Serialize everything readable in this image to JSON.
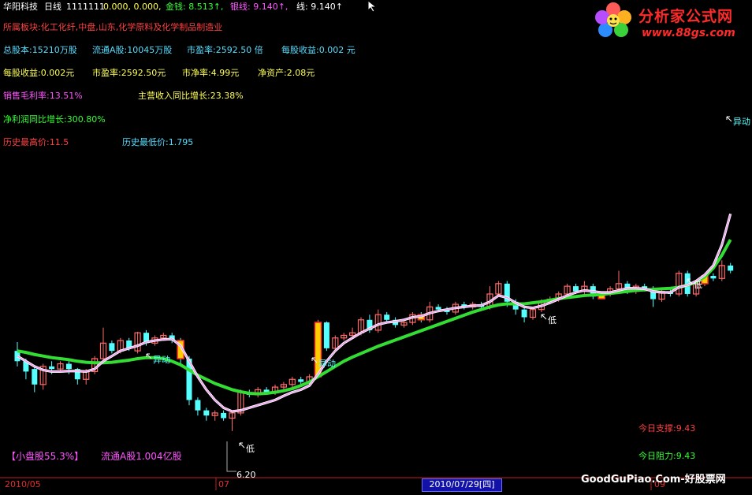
{
  "header": {
    "stock_name": "华阳科技",
    "period": "日线",
    "params": "1111111",
    "values": "0.000, 0.000,",
    "gold_label": "金钱: 8.513↑,",
    "silver_label": "银线: 9.140↑,",
    "line_label": "线: 9.140↑"
  },
  "logo": {
    "title": "分析家公式网",
    "url": "www.88gs.com"
  },
  "info": {
    "sector": "所属板块:化工化纤,中盘,山东,化学原料及化学制品制造业",
    "total_shares": "总股本:15210万股",
    "float_a": "流通A股:10045万股",
    "pe_1": "市盈率:2592.50 倍",
    "eps_1": "每股收益:0.002 元",
    "eps_2": "每股收益:0.002元",
    "pe_2": "市盈率:2592.50元",
    "pb": "市净率:4.99元",
    "nav": "净资产:2.08元",
    "gross_margin": "销售毛利率:13.51%",
    "revenue_growth": "主营收入同比增长:23.38%",
    "profit_growth": "净利润同比增长:300.80%",
    "hist_high": "历史最高价:11.5",
    "hist_low": "历史最低价:1.795"
  },
  "annotations": {
    "yidong": "异动",
    "di": "低",
    "low_price": "6.20"
  },
  "bottom_left": {
    "small_cap": "【小盘股55.3%】",
    "float_shares": "流通A股1.004亿股"
  },
  "bottom_right": {
    "support": "今日支撑:9.43",
    "resistance": "今日阻力:9.43"
  },
  "axis": {
    "label_left": "2010/05",
    "label_mid": "07",
    "label_right": "09",
    "selected_date": "2010/07/29[四]"
  },
  "watermark": "GoodGuPiao.Com-好股票网",
  "colors": {
    "up": "#ff6a6a",
    "down": "#55ffff",
    "green_line": "#33dd33",
    "pink_line": "#f0a0f0"
  },
  "chart_data": {
    "type": "candlestick",
    "y_range": [
      6.0,
      10.8
    ],
    "candles": [
      [
        7.75,
        7.55,
        7.92,
        7.45
      ],
      [
        7.55,
        7.35,
        7.6,
        7.2
      ],
      [
        7.4,
        7.1,
        7.45,
        6.95
      ],
      [
        7.1,
        7.45,
        7.5,
        7.0
      ],
      [
        7.45,
        7.4,
        7.55,
        7.3
      ],
      [
        7.4,
        7.5,
        7.55,
        7.35
      ],
      [
        7.5,
        7.4,
        7.55,
        7.3
      ],
      [
        7.4,
        7.2,
        7.42,
        7.1
      ],
      [
        7.2,
        7.35,
        7.4,
        7.1
      ],
      [
        7.35,
        7.6,
        7.65,
        7.3
      ],
      [
        7.6,
        7.9,
        8.2,
        7.55
      ],
      [
        7.9,
        7.75,
        7.95,
        7.7
      ],
      [
        7.75,
        7.95,
        8.0,
        7.7
      ],
      [
        7.95,
        7.8,
        8.0,
        7.75
      ],
      [
        7.75,
        8.1,
        8.12,
        7.7
      ],
      [
        8.1,
        7.9,
        8.15,
        7.85
      ],
      [
        7.9,
        8.0,
        8.05,
        7.85
      ],
      [
        8.0,
        8.05,
        8.1,
        7.95
      ],
      [
        8.05,
        7.95,
        8.1,
        7.9
      ],
      [
        7.95,
        7.6,
        8.0,
        7.5
      ],
      [
        7.6,
        6.8,
        7.65,
        6.7
      ],
      [
        6.8,
        6.6,
        6.85,
        6.5
      ],
      [
        6.6,
        6.5,
        6.65,
        6.4
      ],
      [
        6.5,
        6.55,
        6.6,
        6.4
      ],
      [
        6.55,
        6.45,
        6.6,
        6.4
      ],
      [
        6.45,
        6.55,
        6.6,
        6.2
      ],
      [
        6.55,
        6.95,
        7.0,
        6.5
      ],
      [
        6.95,
        6.9,
        7.0,
        6.85
      ],
      [
        6.9,
        7.0,
        7.05,
        6.85
      ],
      [
        7.0,
        6.95,
        7.05,
        6.9
      ],
      [
        6.95,
        7.05,
        7.1,
        6.9
      ],
      [
        7.05,
        7.1,
        7.15,
        6.95
      ],
      [
        7.1,
        7.2,
        7.25,
        7.0
      ],
      [
        7.2,
        7.15,
        7.25,
        7.1
      ],
      [
        7.15,
        7.25,
        7.3,
        7.1
      ],
      [
        7.25,
        8.3,
        8.35,
        7.9
      ],
      [
        8.3,
        7.8,
        8.32,
        7.75
      ],
      [
        7.8,
        8.0,
        8.05,
        7.75
      ],
      [
        8.0,
        8.05,
        8.1,
        7.95
      ],
      [
        8.05,
        8.1,
        8.2,
        8.0
      ],
      [
        8.1,
        8.35,
        8.4,
        8.05
      ],
      [
        8.35,
        8.15,
        8.45,
        8.1
      ],
      [
        8.15,
        8.45,
        8.55,
        8.1
      ],
      [
        8.45,
        8.35,
        8.5,
        8.3
      ],
      [
        8.35,
        8.25,
        8.4,
        8.2
      ],
      [
        8.25,
        8.3,
        8.35,
        8.2
      ],
      [
        8.3,
        8.45,
        8.5,
        8.25
      ],
      [
        8.45,
        8.35,
        8.5,
        8.3
      ],
      [
        8.35,
        8.6,
        8.7,
        8.3
      ],
      [
        8.6,
        8.55,
        8.65,
        8.5
      ],
      [
        8.55,
        8.5,
        8.6,
        8.45
      ],
      [
        8.5,
        8.65,
        8.7,
        8.45
      ],
      [
        8.65,
        8.6,
        8.7,
        8.55
      ],
      [
        8.6,
        8.65,
        8.7,
        8.55
      ],
      [
        8.65,
        8.6,
        8.7,
        8.55
      ],
      [
        8.6,
        8.85,
        9.0,
        8.55
      ],
      [
        8.85,
        9.05,
        9.1,
        8.8
      ],
      [
        9.05,
        8.7,
        9.1,
        8.6
      ],
      [
        8.7,
        8.55,
        8.75,
        8.45
      ],
      [
        8.55,
        8.4,
        8.6,
        8.3
      ],
      [
        8.4,
        8.55,
        8.6,
        8.35
      ],
      [
        8.55,
        8.7,
        8.75,
        8.5
      ],
      [
        8.7,
        8.75,
        8.8,
        8.65
      ],
      [
        8.75,
        8.85,
        8.9,
        8.7
      ],
      [
        8.85,
        9.0,
        9.05,
        8.8
      ],
      [
        9.0,
        8.9,
        9.05,
        8.85
      ],
      [
        8.9,
        9.0,
        9.1,
        8.85
      ],
      [
        9.0,
        8.8,
        9.05,
        8.75
      ],
      [
        8.8,
        8.85,
        8.9,
        8.75
      ],
      [
        8.85,
        8.95,
        9.0,
        8.8
      ],
      [
        8.95,
        9.05,
        9.3,
        8.85
      ],
      [
        9.05,
        8.9,
        9.1,
        8.85
      ],
      [
        8.9,
        9.0,
        9.05,
        8.85
      ],
      [
        9.0,
        8.95,
        9.05,
        8.9
      ],
      [
        8.95,
        8.75,
        9.0,
        8.6
      ],
      [
        8.75,
        8.9,
        8.95,
        8.7
      ],
      [
        8.9,
        8.85,
        8.95,
        8.8
      ],
      [
        8.85,
        9.25,
        9.3,
        8.8
      ],
      [
        9.25,
        8.85,
        9.3,
        8.8
      ],
      [
        8.85,
        9.05,
        9.1,
        8.8
      ],
      [
        9.05,
        9.2,
        9.25,
        9.0
      ],
      [
        9.2,
        9.15,
        9.25,
        9.1
      ],
      [
        9.15,
        9.4,
        9.5,
        9.1
      ],
      [
        9.4,
        9.3,
        9.45,
        9.25
      ]
    ],
    "markers_orange": [
      19,
      35,
      47,
      68,
      80
    ],
    "green_ma": [
      7.75,
      7.72,
      7.68,
      7.65,
      7.62,
      7.6,
      7.58,
      7.55,
      7.53,
      7.52,
      7.52,
      7.53,
      7.55,
      7.57,
      7.6,
      7.62,
      7.62,
      7.6,
      7.55,
      7.48,
      7.38,
      7.28,
      7.2,
      7.12,
      7.06,
      7.0,
      6.96,
      6.93,
      6.92,
      6.93,
      6.95,
      6.98,
      7.02,
      7.08,
      7.15,
      7.25,
      7.35,
      7.45,
      7.55,
      7.63,
      7.7,
      7.77,
      7.84,
      7.9,
      7.96,
      8.02,
      8.08,
      8.14,
      8.2,
      8.26,
      8.32,
      8.38,
      8.44,
      8.5,
      8.55,
      8.6,
      8.64,
      8.66,
      8.66,
      8.66,
      8.68,
      8.7,
      8.73,
      8.76,
      8.78,
      8.8,
      8.82,
      8.83,
      8.84,
      8.86,
      8.88,
      8.9,
      8.92,
      8.93,
      8.94,
      8.95,
      8.96,
      8.98,
      9.02,
      9.08,
      9.18,
      9.35,
      9.6,
      9.9
    ],
    "pink_ma": [
      7.65,
      7.55,
      7.45,
      7.38,
      7.35,
      7.35,
      7.36,
      7.36,
      7.35,
      7.4,
      7.55,
      7.65,
      7.75,
      7.8,
      7.85,
      7.92,
      7.95,
      7.97,
      7.98,
      7.85,
      7.55,
      7.25,
      7.0,
      6.8,
      6.65,
      6.58,
      6.6,
      6.65,
      6.7,
      6.75,
      6.8,
      6.88,
      6.95,
      7.0,
      7.08,
      7.3,
      7.55,
      7.75,
      7.9,
      8.0,
      8.1,
      8.18,
      8.26,
      8.3,
      8.32,
      8.35,
      8.4,
      8.42,
      8.48,
      8.52,
      8.55,
      8.58,
      8.6,
      8.62,
      8.63,
      8.7,
      8.82,
      8.78,
      8.68,
      8.6,
      8.58,
      8.62,
      8.68,
      8.75,
      8.82,
      8.88,
      8.92,
      8.9,
      8.88,
      8.88,
      8.92,
      8.96,
      8.96,
      8.95,
      8.9,
      8.88,
      8.88,
      8.98,
      9.02,
      9.1,
      9.22,
      9.4,
      9.8,
      10.4
    ]
  }
}
